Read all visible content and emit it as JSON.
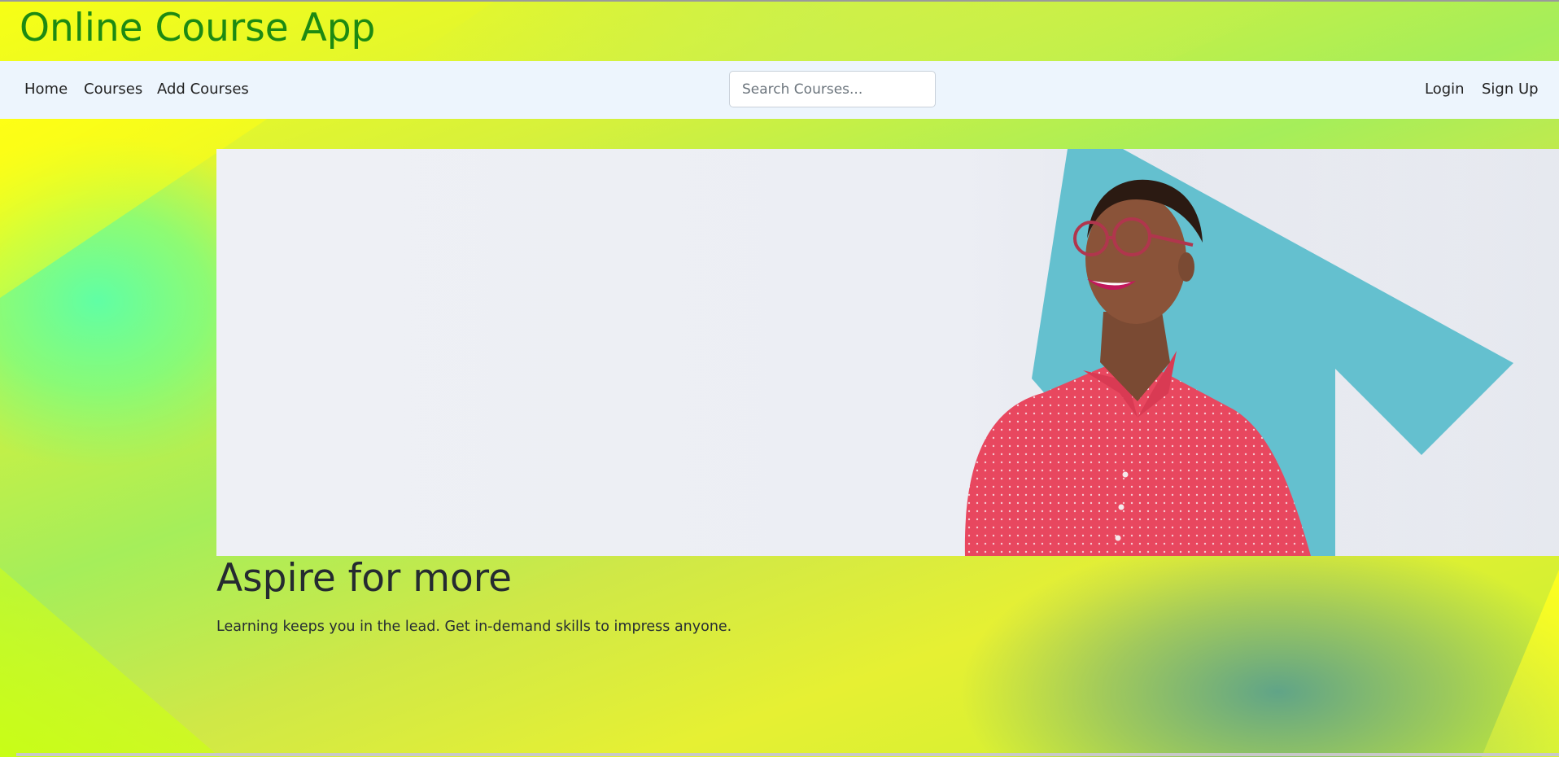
{
  "header": {
    "app_title": "Online Course App"
  },
  "navbar": {
    "links": [
      {
        "label": "Home"
      },
      {
        "label": "Courses"
      },
      {
        "label": "Add Courses"
      }
    ],
    "search": {
      "placeholder": "Search Courses...",
      "value": ""
    },
    "auth_links": [
      {
        "label": "Login"
      },
      {
        "label": "Sign Up"
      }
    ]
  },
  "hero": {
    "image": "smiling-woman-with-glasses-red-polka-dot-shirt-blue-up-arrow",
    "title": "Aspire for more",
    "subtitle": "Learning keeps you in the lead. Get in-demand skills to impress anyone."
  },
  "colors": {
    "title_green": "#1d8a12",
    "navbar_bg": "#edf5fd",
    "hero_bg": "#eef0f5",
    "arrow_blue": "#64c0cf",
    "shirt_red": "#e8475f",
    "background_yellow": "#f7ff15",
    "background_green": "#5cffa8"
  }
}
